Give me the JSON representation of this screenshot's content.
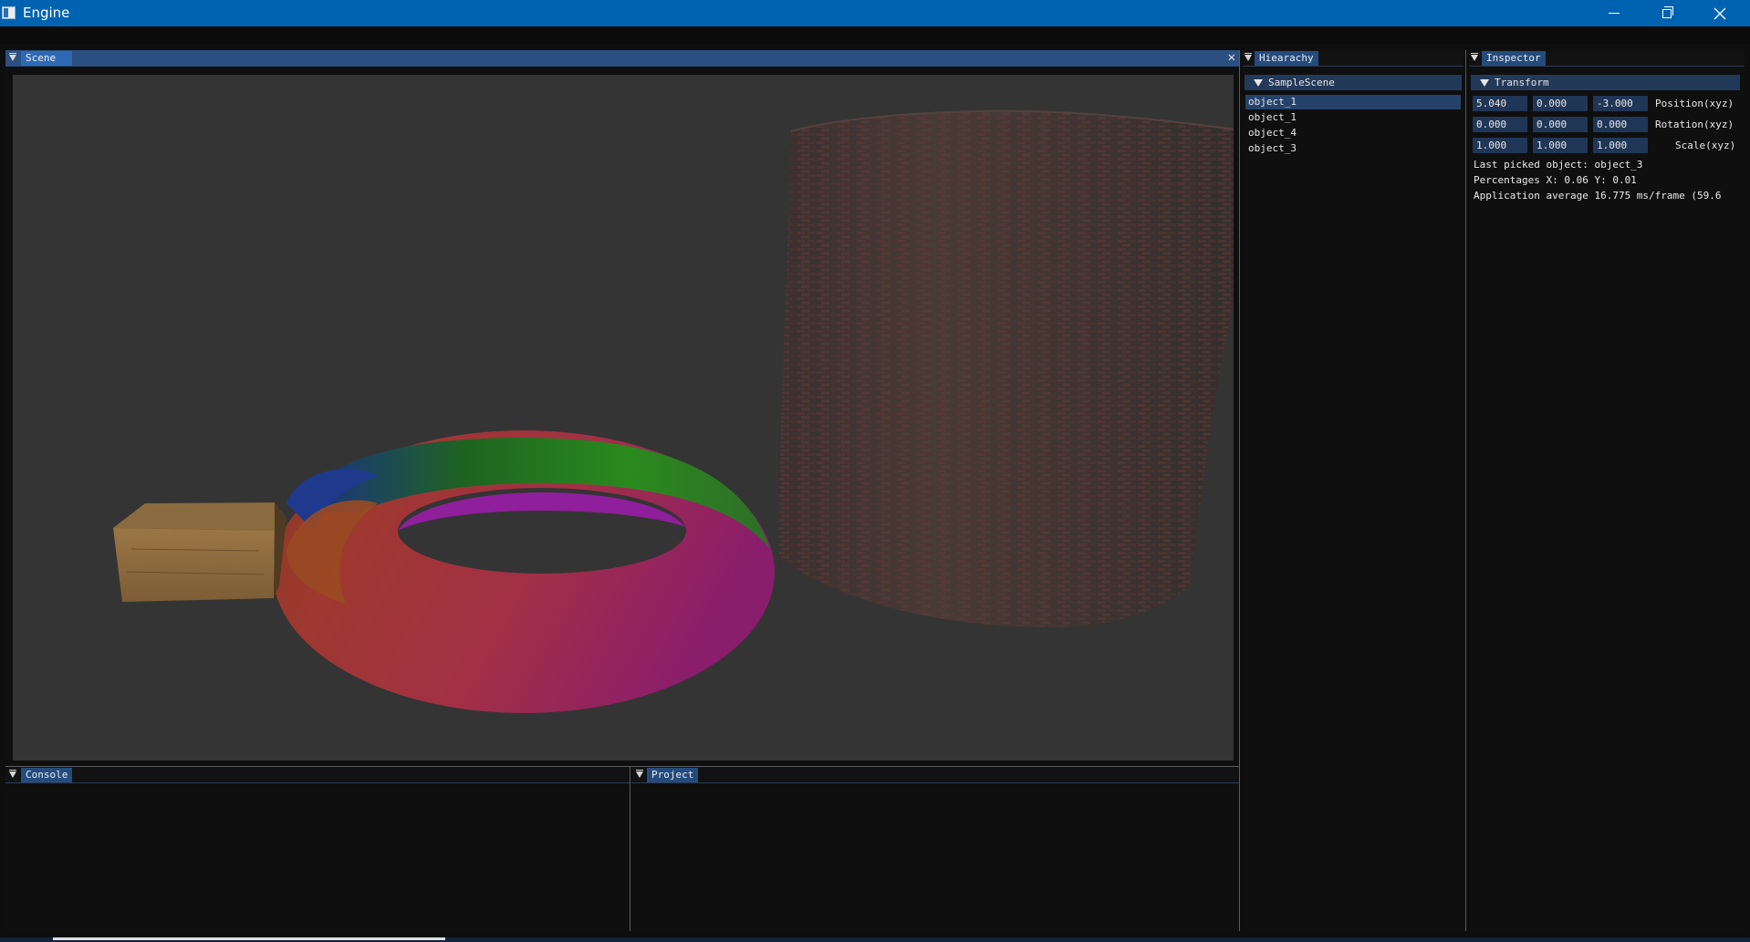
{
  "window": {
    "title": "Engine"
  },
  "scene": {
    "tab_label": "Scene",
    "close_glyph": "✕"
  },
  "console": {
    "tab_label": "Console"
  },
  "project": {
    "tab_label": "Project"
  },
  "hierarchy": {
    "tab_label": "Hiearachy",
    "root_label": "SampleScene",
    "items": [
      {
        "label": "object_1",
        "selected": true
      },
      {
        "label": "object_1",
        "selected": false
      },
      {
        "label": "object_4",
        "selected": false
      },
      {
        "label": "object_3",
        "selected": false
      }
    ]
  },
  "inspector": {
    "tab_label": "Inspector",
    "section_label": "Transform",
    "position": {
      "label": "Position(xyz)",
      "x": "5.040",
      "y": "0.000",
      "z": "-3.000"
    },
    "rotation": {
      "label": "Rotation(xyz)",
      "x": "0.000",
      "y": "0.000",
      "z": "0.000"
    },
    "scale": {
      "label": "Scale(xyz)",
      "x": "1.000",
      "y": "1.000",
      "z": "1.000"
    },
    "last_picked": "Last picked object: object_3",
    "percentages": "Percentages X: 0.06 Y: 0.01",
    "app_average": "Application average 16.775 ms/frame (59.6"
  },
  "colors": {
    "titlebar": "#0063b1",
    "tab_active": "#2f69b5",
    "tab_inactive": "#244b7c",
    "selection": "#25426b",
    "viewport_bg": "#343434"
  },
  "icons": [
    "window-app-icon",
    "minimize-icon",
    "maximize-icon",
    "close-icon",
    "collapse-triangle-icon"
  ]
}
